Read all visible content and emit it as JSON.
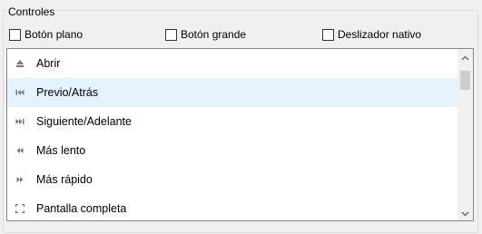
{
  "group": {
    "title": "Controles"
  },
  "checkboxes": [
    {
      "label": "Botón plano",
      "checked": false
    },
    {
      "label": "Botón grande",
      "checked": false
    },
    {
      "label": "Deslizador nativo",
      "checked": false
    }
  ],
  "list": {
    "items": [
      {
        "label": "Abrir",
        "icon": "eject-icon",
        "selected": false
      },
      {
        "label": "Previo/Atrás",
        "icon": "skip-previous-icon",
        "selected": true
      },
      {
        "label": "Siguiente/Adelante",
        "icon": "skip-next-icon",
        "selected": false
      },
      {
        "label": "Más lento",
        "icon": "rewind-icon",
        "selected": false
      },
      {
        "label": "Más rápido",
        "icon": "fast-forward-icon",
        "selected": false
      },
      {
        "label": "Pantalla completa",
        "icon": "fullscreen-icon",
        "selected": false
      }
    ]
  },
  "colors": {
    "selection": "#e5f3ff",
    "border": "#828790",
    "icon": "#777777"
  }
}
